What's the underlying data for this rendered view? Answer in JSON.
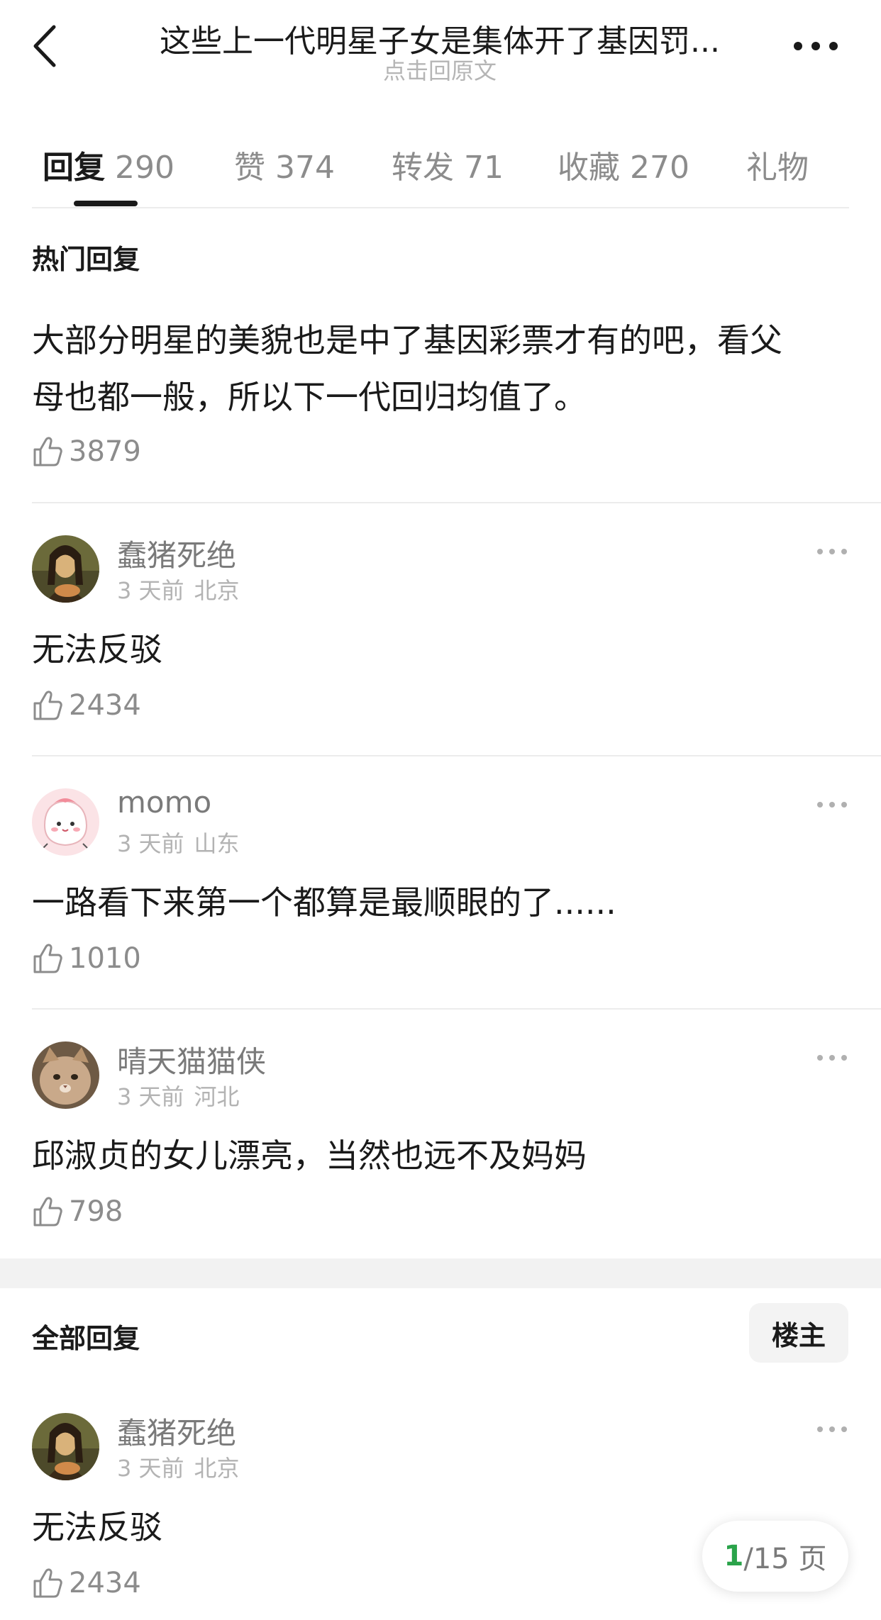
{
  "header": {
    "title": "这些上一代明星子女是集体开了基因罚...",
    "subtitle": "点击回原文",
    "back_icon": "chevron-left-icon",
    "more_icon": "more-horizontal-icon"
  },
  "tabs": [
    {
      "label": "回复",
      "count": "290",
      "active": true
    },
    {
      "label": "赞",
      "count": "374",
      "active": false
    },
    {
      "label": "转发",
      "count": "71",
      "active": false
    },
    {
      "label": "收藏",
      "count": "270",
      "active": false
    },
    {
      "label": "礼物",
      "count": "",
      "active": false
    }
  ],
  "hot": {
    "section_title": "热门回复",
    "top": {
      "text_line1": "大部分明星的美貌也是中了基因彩票才有的吧，看父",
      "text_line2": "母也都一般，所以下一代回归均值了。",
      "likes": "3879"
    },
    "comments": [
      {
        "username": "蠢猪死绝",
        "time": "3 天前",
        "location": "北京",
        "text": "无法反驳",
        "likes": "2434",
        "avatar": "mona-lisa-avatar"
      },
      {
        "username": "momo",
        "time": "3 天前",
        "location": "山东",
        "text": "一路看下来第一个都算是最顺眼的了......",
        "likes": "1010",
        "avatar": "pink-cartoon-avatar"
      },
      {
        "username": "晴天猫猫侠",
        "time": "3 天前",
        "location": "河北",
        "text": "邱淑贞的女儿漂亮，当然也远不及妈妈",
        "likes": "798",
        "avatar": "cat-avatar"
      }
    ]
  },
  "all": {
    "section_title": "全部回复",
    "owner_button": "楼主",
    "comments": [
      {
        "username": "蠢猪死绝",
        "time": "3 天前",
        "location": "北京",
        "text": "无法反驳",
        "likes": "2434",
        "avatar": "mona-lisa-avatar"
      }
    ]
  },
  "pager": {
    "current": "1",
    "rest": "/15 页"
  },
  "colors": {
    "accent_green": "#2aa34a",
    "muted": "#8c8c8c",
    "divider": "#ececec"
  }
}
